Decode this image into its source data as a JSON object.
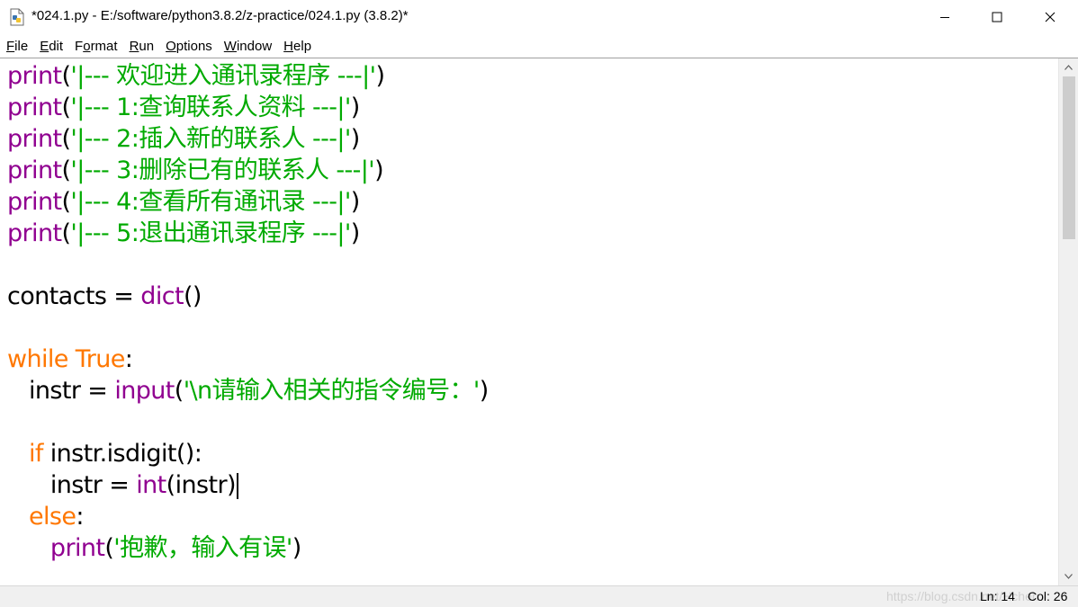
{
  "window": {
    "title": "*024.1.py - E:/software/python3.8.2/z-practice/024.1.py (3.8.2)*"
  },
  "menu": [
    {
      "u": "F",
      "rest": "ile"
    },
    {
      "u": "E",
      "rest": "dit"
    },
    {
      "pre": "F",
      "u": "o",
      "rest": "rmat"
    },
    {
      "u": "R",
      "rest": "un"
    },
    {
      "u": "O",
      "rest": "ptions"
    },
    {
      "u": "W",
      "rest": "indow"
    },
    {
      "u": "H",
      "rest": "elp"
    }
  ],
  "code": {
    "l1": {
      "fn": "print",
      "p1": "(",
      "s": "'|--- 欢迎进入通讯录程序 ---|'",
      "p2": ")"
    },
    "l2": {
      "fn": "print",
      "p1": "(",
      "s": "'|--- 1:查询联系人资料 ---|'",
      "p2": ")"
    },
    "l3": {
      "fn": "print",
      "p1": "(",
      "s": "'|--- 2:插入新的联系人 ---|'",
      "p2": ")"
    },
    "l4": {
      "fn": "print",
      "p1": "(",
      "s": "'|--- 3:删除已有的联系人 ---|'",
      "p2": ")"
    },
    "l5": {
      "fn": "print",
      "p1": "(",
      "s": "'|--- 4:查看所有通讯录 ---|'",
      "p2": ")"
    },
    "l6": {
      "fn": "print",
      "p1": "(",
      "s": "'|--- 5:退出通讯录程序 ---|'",
      "p2": ")"
    },
    "l8": {
      "a": "contacts = ",
      "fn": "dict",
      "b": "()"
    },
    "l10": {
      "kw1": "while",
      "sp": " ",
      "kw2": "True",
      "c": ":"
    },
    "l11": {
      "a": "   instr = ",
      "fn": "input",
      "p1": "(",
      "s": "'\\n请输入相关的指令编号：'",
      "p2": ")"
    },
    "l13": {
      "ind": "   ",
      "kw": "if",
      "rest": " instr.isdigit():"
    },
    "l14": {
      "a": "      instr = ",
      "fn": "int",
      "b": "(instr)"
    },
    "l15": {
      "ind": "   ",
      "kw": "else",
      "c": ":"
    },
    "l16": {
      "ind": "      ",
      "fn": "print",
      "p1": "(",
      "s": "'抱歉，输入有误'",
      "p2": ")"
    }
  },
  "status": {
    "watermark": "https://blog.csdn.net/Hchen",
    "ln": "Ln: 14",
    "col": "Col: 26"
  },
  "colors": {
    "keyword": "#ff7700",
    "builtin": "#900090",
    "string": "#00aa00",
    "default": "#000000"
  }
}
